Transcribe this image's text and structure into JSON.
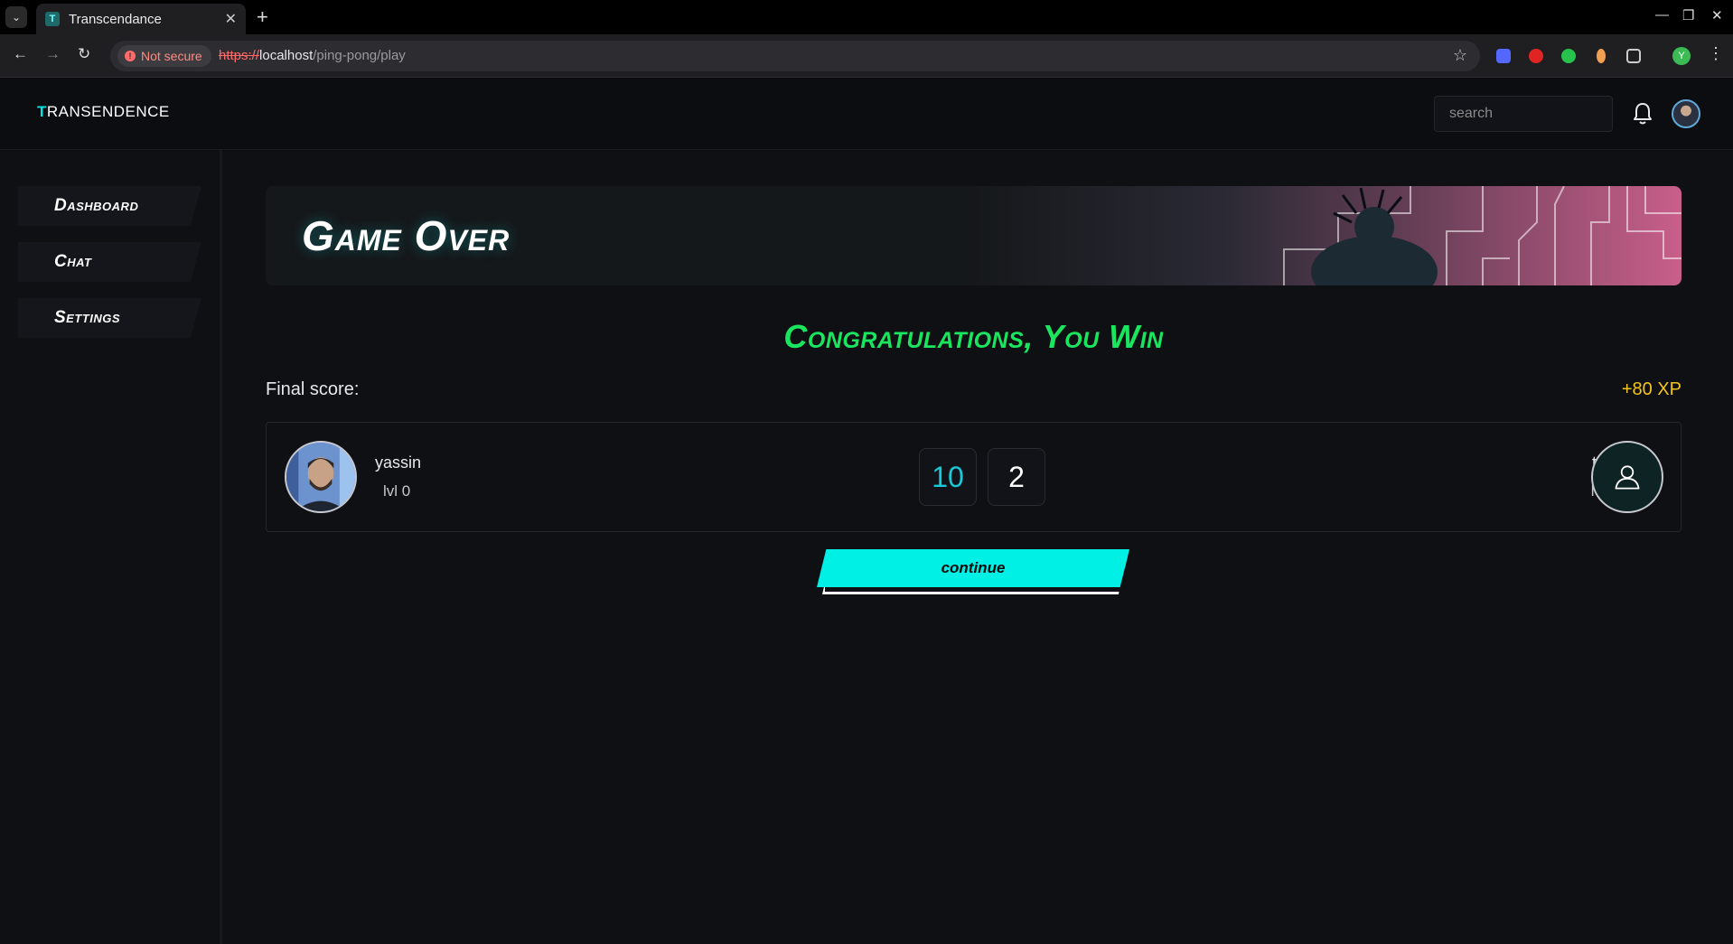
{
  "browser": {
    "tab_title": "Transcendance",
    "tab_favicon": "T",
    "security_label": "Not secure",
    "url_scheme": "https://",
    "url_host": "localhost",
    "url_path": "/ping-pong/play",
    "profile_initial": "Y"
  },
  "header": {
    "logo_initial": "T",
    "logo_rest": "RANSENDENCE",
    "search_placeholder": "search"
  },
  "sidebar": {
    "items": [
      {
        "label": "Dashboard"
      },
      {
        "label": "Chat"
      },
      {
        "label": "Settings"
      }
    ]
  },
  "main": {
    "banner_title": "Game Over",
    "result_message": "Congratulations, You Win",
    "final_score_label": "Final score:",
    "xp_gain": "+80 XP",
    "continue_label": "continue"
  },
  "players": {
    "left": {
      "name": "yassin",
      "level": "lvl 0",
      "score": "10"
    },
    "right": {
      "name": "test",
      "level": "lvl 0",
      "score": "2"
    }
  },
  "colors": {
    "accent": "#00f0e6",
    "win": "#19e65e",
    "xp": "#f5c518",
    "left_score": "#19c9d8",
    "right_score": "#ffffff"
  }
}
